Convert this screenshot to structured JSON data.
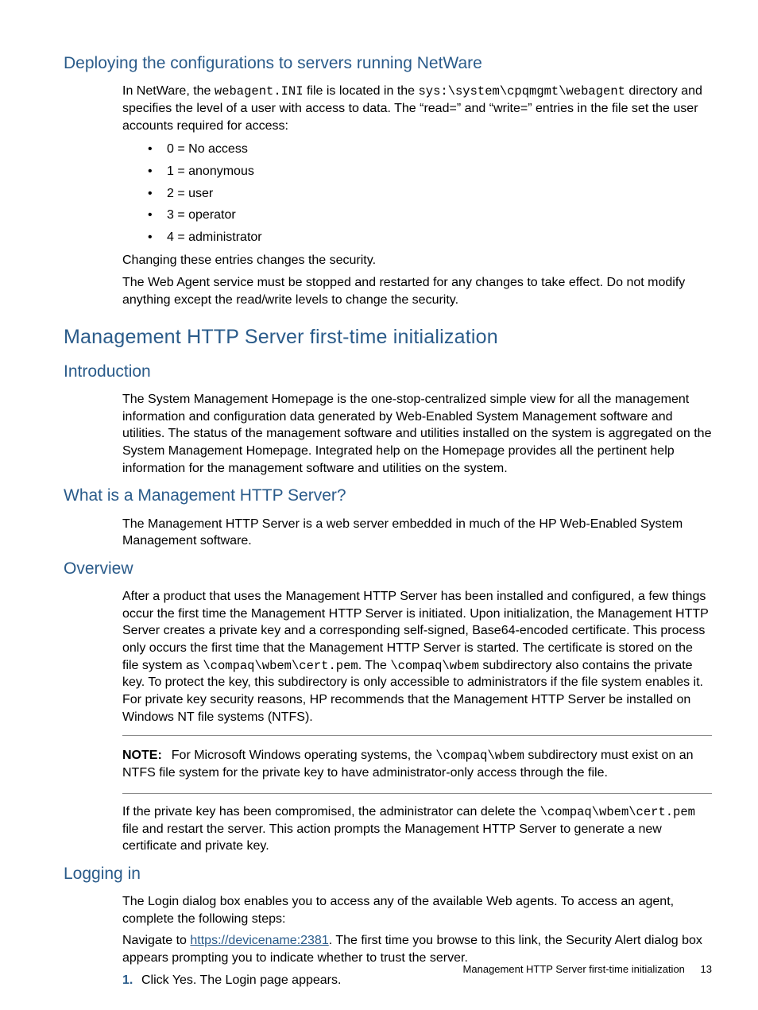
{
  "s1": {
    "title": "Deploying the configurations to servers running NetWare",
    "p1a": "In NetWare, the ",
    "p1_code1": "webagent.INI",
    "p1b": " file is located in the ",
    "p1_code2": "sys:\\system\\cpqmgmt\\webagent",
    "p1c": " directory and specifies the level of a user with access to data. The “read=” and “write=” entries in the file set the user accounts required for access:",
    "bullets": [
      "0 = No access",
      "1 = anonymous",
      "2 = user",
      "3 = operator",
      "4 = administrator"
    ],
    "p2": "Changing these entries changes the security.",
    "p3": "The Web Agent service must be stopped and restarted for any changes to take effect. Do not modify anything except the read/write levels to change the security."
  },
  "s2": {
    "title": "Management HTTP Server first-time initialization",
    "intro_h": "Introduction",
    "intro_p": "The System Management Homepage is the one-stop-centralized simple view for all the management information and configuration data generated by Web-Enabled System Management software and utilities. The status of the management software and utilities installed on the system is aggregated on the System Management Homepage. Integrated help on the Homepage provides all the pertinent help information for the management software and utilities on the system.",
    "what_h": "What is a Management HTTP Server?",
    "what_p": "The Management HTTP Server is a web server embedded in much of the HP Web-Enabled System Management software.",
    "ov_h": "Overview",
    "ov_p_a": "After a product that uses the Management HTTP Server has been installed and configured, a few things occur the first time the Management HTTP Server is initiated. Upon initialization, the Management HTTP Server creates a private key and a corresponding self-signed, Base64-encoded certificate. This process only occurs the first time that the Management HTTP Server is started. The certificate is stored on the file system as ",
    "ov_code1": "\\compaq\\wbem\\cert.pem",
    "ov_p_b": ". The ",
    "ov_code2": "\\compaq\\wbem",
    "ov_p_c": " subdirectory also contains the private key. To protect the key, this subdirectory is only accessible to administrators if the file system enables it. For private key security reasons, HP recommends that the Management HTTP Server be installed on Windows NT file systems (NTFS).",
    "note_label": "NOTE:",
    "note_a": "For Microsoft Windows operating systems, the ",
    "note_code": "\\compaq\\wbem",
    "note_b": " subdirectory must exist on an NTFS file system for the private key to have administrator-only access through the file.",
    "post_a": "If the private key has been compromised, the administrator can delete the ",
    "post_code": "\\compaq\\wbem\\cert.pem",
    "post_b": " file and restart the server. This action prompts the Management HTTP Server to generate a new certificate and private key.",
    "log_h": "Logging in",
    "log_p1": "The Login dialog box enables you to access any of the available Web agents. To access an agent, complete the following steps:",
    "log_p2a": "Navigate to ",
    "log_link": "https://devicename:2381",
    "log_p2b": ". The first time you browse to this link, the Security Alert dialog box appears prompting you to indicate whether to trust the server.",
    "step1_num": "1.",
    "step1_txt": "Click Yes. The Login page appears."
  },
  "footer": {
    "text": "Management HTTP Server first-time initialization",
    "page": "13"
  }
}
